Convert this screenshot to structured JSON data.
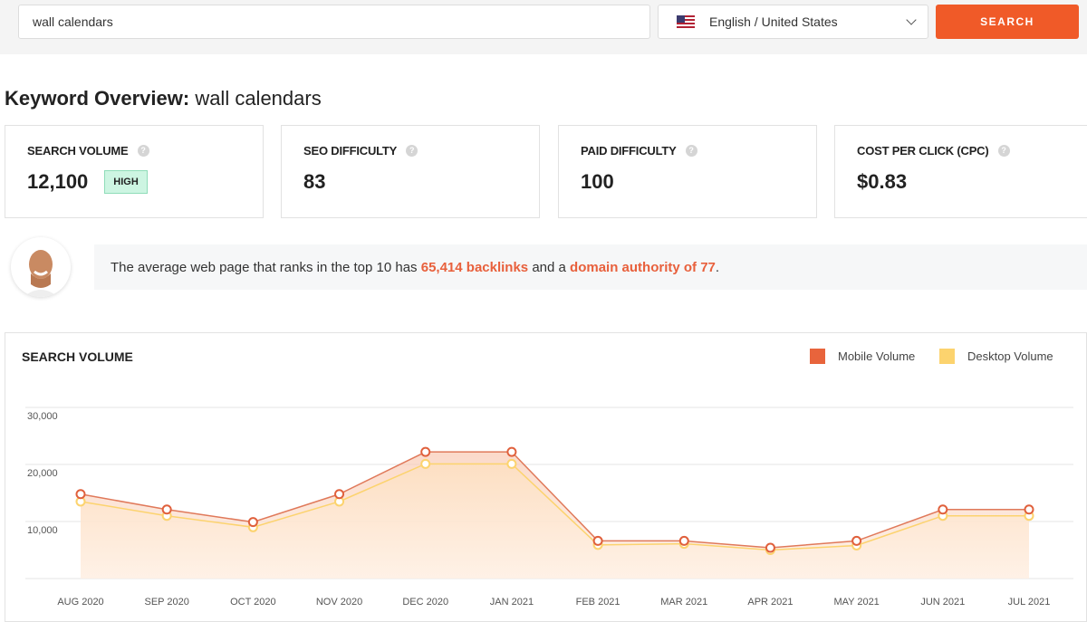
{
  "search": {
    "value": "wall calendars",
    "language": "English / United States",
    "button": "SEARCH"
  },
  "overview": {
    "label": "Keyword Overview:",
    "keyword": "wall calendars"
  },
  "cards": [
    {
      "label": "SEARCH VOLUME",
      "value": "12,100",
      "badge": "HIGH"
    },
    {
      "label": "SEO DIFFICULTY",
      "value": "83"
    },
    {
      "label": "PAID DIFFICULTY",
      "value": "100"
    },
    {
      "label": "COST PER CLICK (CPC)",
      "value": "$0.83"
    }
  ],
  "tip": {
    "pre": "The average web page that ranks in the top 10 has ",
    "backlinks": "65,414 backlinks",
    "mid": " and a ",
    "authority": "domain authority of 77",
    "post": "."
  },
  "chart_data": {
    "type": "area",
    "title": "SEARCH VOLUME",
    "categories": [
      "AUG 2020",
      "SEP 2020",
      "OCT 2020",
      "NOV 2020",
      "DEC 2020",
      "JAN 2021",
      "FEB 2021",
      "MAR 2021",
      "APR 2021",
      "MAY 2021",
      "JUN 2021",
      "JUL 2021"
    ],
    "series": [
      {
        "name": "Mobile Volume",
        "color": "#e8643c",
        "values": [
          14800,
          12100,
          9900,
          14800,
          22200,
          22200,
          6600,
          6600,
          5400,
          6600,
          12100,
          12100
        ]
      },
      {
        "name": "Desktop Volume",
        "color": "#fcd36e",
        "values": [
          13500,
          11000,
          9000,
          13500,
          20100,
          20100,
          5900,
          6100,
          5000,
          5800,
          11000,
          11000
        ]
      }
    ],
    "yticks": [
      "10,000",
      "20,000",
      "30,000"
    ],
    "ylim": [
      0,
      30000
    ],
    "grid": true,
    "legend": "top-right"
  }
}
